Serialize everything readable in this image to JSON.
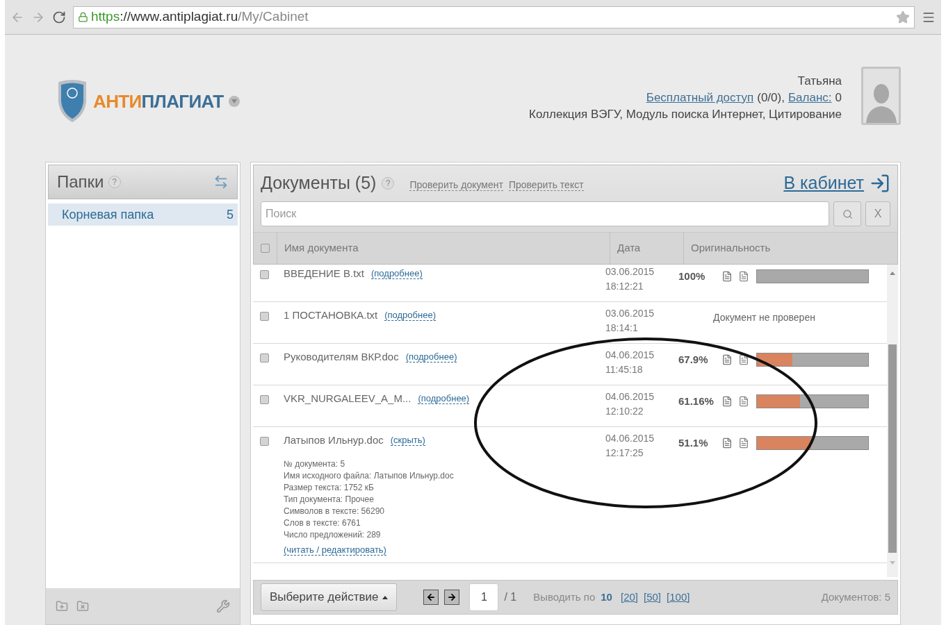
{
  "browser": {
    "url_scheme": "https",
    "url_host": "://www.antiplagiat.ru",
    "url_path": "/My/Cabinet"
  },
  "logo": {
    "part_1": "АНТИ",
    "part_2": "ПЛАГИАТ"
  },
  "user": {
    "name": "Татьяна",
    "free_access_link": "Бесплатный доступ",
    "free_access_count": "(0/0),",
    "balance_link": "Баланс:",
    "balance_value": "0",
    "modules": "Коллекция ВЭГУ, Модуль поиска Интернет, Цитирование"
  },
  "folders": {
    "title": "Папки",
    "help": "?",
    "items": [
      {
        "name": "Корневая папка",
        "count": "5",
        "selected": true
      }
    ]
  },
  "documents": {
    "title": "Документы",
    "count": "(5)",
    "help": "?",
    "links": [
      "Проверить документ",
      "Проверить текст"
    ],
    "cabinet_link": "В кабинет",
    "search": {
      "placeholder": "Поиск"
    },
    "clear_button": "X",
    "select_all_checked": false,
    "columns": [
      "Имя документа",
      "Дата",
      "Оригинальность"
    ],
    "rows": [
      {
        "checked": false,
        "name": "ВВЕДЕНИЕ В.txt",
        "link": "(подробнее)",
        "date": "03.06.2015",
        "time": "18:12:21",
        "kind": "checked",
        "originality": "100%"
      },
      {
        "checked": false,
        "name": "1 ПОСТАНОВКА.txt",
        "link": "(подробнее)",
        "date": "03.06.2015",
        "time": "18:14:1",
        "kind": "unchecked",
        "status": "Документ не проверен"
      },
      {
        "checked": false,
        "name": "Руководителям ВКР.doc",
        "link": "(подробнее)",
        "date": "04.06.2015",
        "time": "11:45:18",
        "kind": "checked",
        "originality": "67.9%",
        "level": 0.32
      },
      {
        "checked": false,
        "name": "VKR_NURGALEEV_A_M...",
        "link": "(подробнее)",
        "date": "04.06.2015",
        "time": "12:10:22",
        "kind": "checked",
        "originality": "61.16%",
        "level": 0.39
      },
      {
        "checked": false,
        "name": "Латыпов Ильнур.doc",
        "link": "(скрыть)",
        "date": "04.06.2015",
        "time": "12:17:25",
        "kind": "checked",
        "originality": "51.1%",
        "level": 0.49,
        "details": [
          "№ документа: 5",
          "Имя исходного файла: Латыпов Ильнур.doc",
          "Размер текста: 1752 кБ",
          "Тип документа: Прочее",
          "Символов в тексте: 56290",
          "Слов в тексте: 6761",
          "Число предложений: 289"
        ],
        "details_link": "(читать / редактировать)"
      }
    ]
  },
  "footer": {
    "action_button": "Выберите действие",
    "page": "1",
    "total_pages": "/ 1",
    "per_page_label": "Выводить по",
    "per_page_options": [
      {
        "label": "10",
        "selected": true
      },
      {
        "label": "[20]",
        "selected": false
      },
      {
        "label": "[50]",
        "selected": false
      },
      {
        "label": "[100]",
        "selected": false
      }
    ],
    "total": "Документов: 5"
  }
}
